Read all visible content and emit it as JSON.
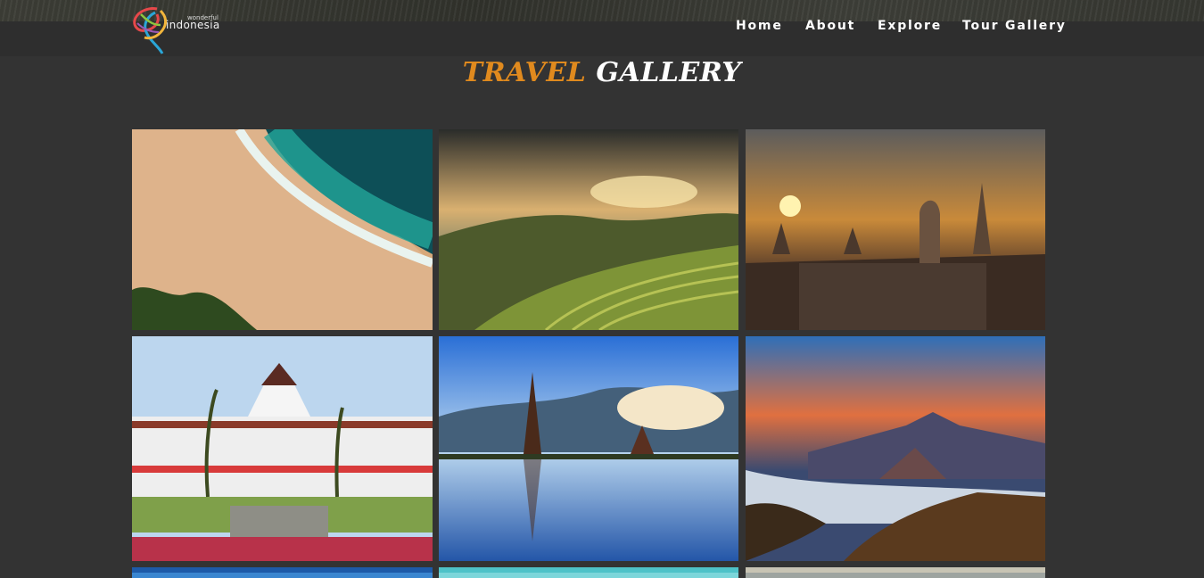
{
  "header": {
    "logo": {
      "small": "wonderful",
      "main": "indonesia"
    },
    "nav": [
      {
        "label": "Home"
      },
      {
        "label": "About"
      },
      {
        "label": "Explore"
      },
      {
        "label": "Tour Gallery"
      }
    ]
  },
  "gallery": {
    "title_part1": "TRAVEL",
    "title_part2": "GALLERY",
    "images": [
      {
        "subject": "aerial beach with turquoise waves"
      },
      {
        "subject": "rice terraces at sunset"
      },
      {
        "subject": "Borobudur temple stupas at sunset"
      },
      {
        "subject": "Gedung Sate building with fountain"
      },
      {
        "subject": "Ulun Danu Beratan lake temple"
      },
      {
        "subject": "Mount Bromo volcano at sunrise"
      }
    ]
  },
  "colors": {
    "background": "#333333",
    "header": "#2e2e2e",
    "accent": "#e08a1e",
    "text": "#ffffff"
  }
}
